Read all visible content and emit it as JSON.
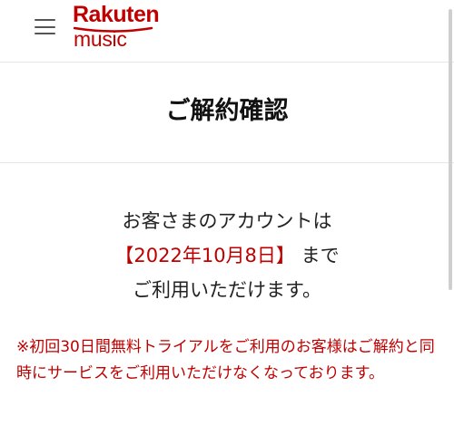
{
  "header": {
    "menu_icon": "hamburger-menu-icon",
    "logo_line1": "Rakuten",
    "logo_line2": "music",
    "brand_color": "#bf0000"
  },
  "page": {
    "title": "ご解約確認"
  },
  "message": {
    "line1": "お客さまのアカウントは",
    "date": "【2022年10月8日】",
    "line2_suffix": " まで",
    "line3": "ご利用いただけます。"
  },
  "notice": {
    "text": "※初回30日間無料トライアルをご利用のお客様はご解約と同時にサービスをご利用いただけなくなっております。"
  },
  "colors": {
    "accent": "#bf0000",
    "divider": "#e6e6e6"
  }
}
